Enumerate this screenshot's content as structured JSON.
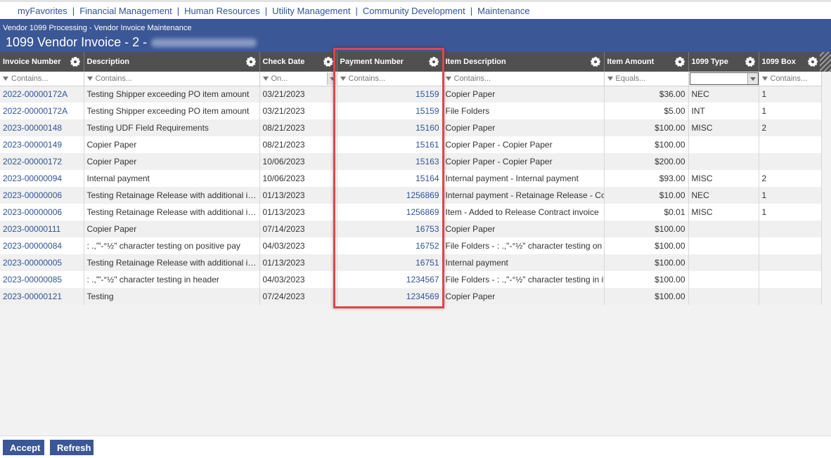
{
  "nav": {
    "items": [
      "myFavorites",
      "Financial Management",
      "Human Resources",
      "Utility Management",
      "Community Development",
      "Maintenance"
    ],
    "separator": "|"
  },
  "header": {
    "breadcrumb": "Vendor 1099 Processing - Vendor Invoice Maintenance",
    "title": "1099 Vendor Invoice - 2 -"
  },
  "grid": {
    "columns": [
      "Invoice Number",
      "Description",
      "Check Date",
      "Payment Number",
      "Item Description",
      "Item Amount",
      "1099 Type",
      "1099 Box"
    ],
    "filters": [
      "Contains...",
      "Contains...",
      "On...",
      "Contains...",
      "Contains...",
      "Equals...",
      "",
      "Contains..."
    ],
    "rows": [
      [
        "2022-00000172A",
        "Testing Shipper exceeding PO item amount",
        "03/21/2023",
        "15159",
        "Copier Paper",
        "$36.00",
        "NEC",
        "1"
      ],
      [
        "2022-00000172A",
        "Testing Shipper exceeding PO item amount",
        "03/21/2023",
        "15159",
        "File Folders",
        "$5.00",
        "INT",
        "1"
      ],
      [
        "2023-00000148",
        "Testing UDF Field Requirements",
        "08/21/2023",
        "15160",
        "Copier Paper",
        "$100.00",
        "MISC",
        "2"
      ],
      [
        "2023-00000149",
        "Copier Paper",
        "08/21/2023",
        "15161",
        "Copier Paper - Copier Paper",
        "$100.00",
        "",
        ""
      ],
      [
        "2022-00000172",
        "Copier Paper",
        "10/06/2023",
        "15163",
        "Copier Paper - Copier Paper",
        "$200.00",
        "",
        ""
      ],
      [
        "2023-00000094",
        "Internal payment",
        "10/06/2023",
        "15164",
        "Internal payment - Internal payment",
        "$93.00",
        "MISC",
        "2"
      ],
      [
        "2023-00000006",
        "Testing Retainage Release with additional it...",
        "01/13/2023",
        "1256869",
        "Internal payment - Retainage Release - Cor",
        "$10.00",
        "NEC",
        "1"
      ],
      [
        "2023-00000006",
        "Testing Retainage Release with additional it...",
        "01/13/2023",
        "1256869",
        "Item - Added to Release Contract invoice",
        "$0.01",
        "MISC",
        "1"
      ],
      [
        "2023-00000111",
        "Copier Paper",
        "07/14/2023",
        "16753",
        "Copier Paper",
        "$100.00",
        "",
        ""
      ],
      [
        "2023-00000084",
        ": .,'\"-°½\" character testing on positive pay",
        "04/03/2023",
        "16752",
        "File Folders - : .,\"-°½\" character testing on p",
        "$100.00",
        "",
        ""
      ],
      [
        "2023-00000005",
        "Testing Retainage Release with additional it...",
        "01/13/2023",
        "16751",
        "Internal payment",
        "$100.00",
        "",
        ""
      ],
      [
        "2023-00000085",
        ": .,'\"-°½\" character testing in header",
        "04/03/2023",
        "1234567",
        "File Folders - : .,\"-°½\" character testing in ite",
        "$100.00",
        "",
        ""
      ],
      [
        "2023-00000121",
        "Testing",
        "07/24/2023",
        "1234569",
        "Copier Paper",
        "$100.00",
        "",
        ""
      ]
    ]
  },
  "footer": {
    "accept_label": "Accept",
    "refresh_label": "Refresh"
  },
  "colors": {
    "header_bg": "#3c5796",
    "column_header_bg": "#505050",
    "link": "#2f5496",
    "highlight_border": "#e0464f"
  }
}
